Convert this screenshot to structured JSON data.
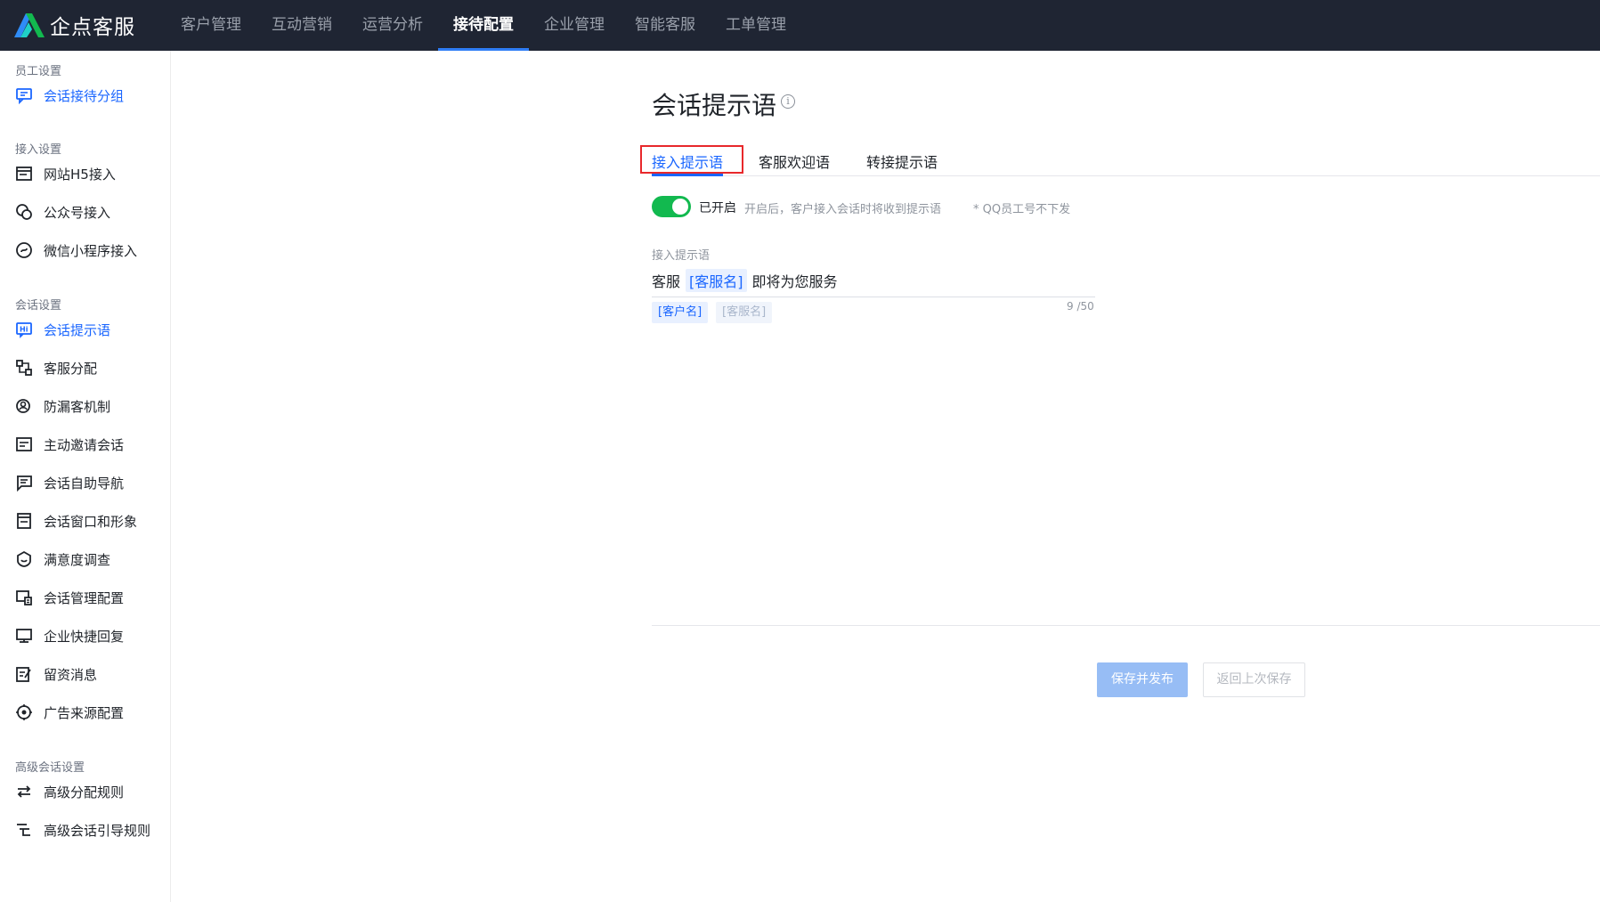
{
  "brand": {
    "name": "企点客服"
  },
  "nav": [
    {
      "label": "客户管理",
      "active": false
    },
    {
      "label": "互动营销",
      "active": false
    },
    {
      "label": "运营分析",
      "active": false
    },
    {
      "label": "接待配置",
      "active": true
    },
    {
      "label": "企业管理",
      "active": false
    },
    {
      "label": "智能客服",
      "active": false
    },
    {
      "label": "工单管理",
      "active": false
    }
  ],
  "sidebar": {
    "groups": [
      {
        "title": "员工设置",
        "items": [
          "会话接待分组"
        ]
      },
      {
        "title": "接入设置",
        "items": [
          "网站H5接入",
          "公众号接入",
          "微信小程序接入"
        ]
      },
      {
        "title": "会话设置",
        "items": [
          "会话提示语",
          "客服分配",
          "防漏客机制",
          "主动邀请会话",
          "会话自助导航",
          "会话窗口和形象",
          "满意度调查",
          "会话管理配置",
          "企业快捷回复",
          "留资消息",
          "广告来源配置"
        ]
      },
      {
        "title": "高级会话设置",
        "items": [
          "高级分配规则",
          "高级会话引导规则"
        ]
      }
    ],
    "active_item": "会话提示语"
  },
  "main": {
    "title": "会话提示语",
    "info_glyph": "i",
    "tabs": [
      {
        "label": "接入提示语",
        "active": true
      },
      {
        "label": "客服欢迎语",
        "active": false
      },
      {
        "label": "转接提示语",
        "active": false
      }
    ],
    "toggle": {
      "state": "on",
      "label": "已开启",
      "hint": "开启后，客户接入会话时将收到提示语",
      "note": "* QQ员工号不下发"
    },
    "field": {
      "label": "接入提示语",
      "prefix": "客服",
      "tag": "[客服名]",
      "suffix": "即将为您服务",
      "counter": "9 /50"
    },
    "chips": [
      {
        "label": "[客户名]",
        "enabled": true
      },
      {
        "label": "[客服名]",
        "enabled": false
      }
    ],
    "buttons": {
      "save": "保存并发布",
      "revert": "返回上次保存"
    }
  },
  "colors": {
    "topbar": "#1f2533",
    "accent": "#1a66ff",
    "toggle_on": "#12b94f",
    "highlight": "#e8282b"
  }
}
